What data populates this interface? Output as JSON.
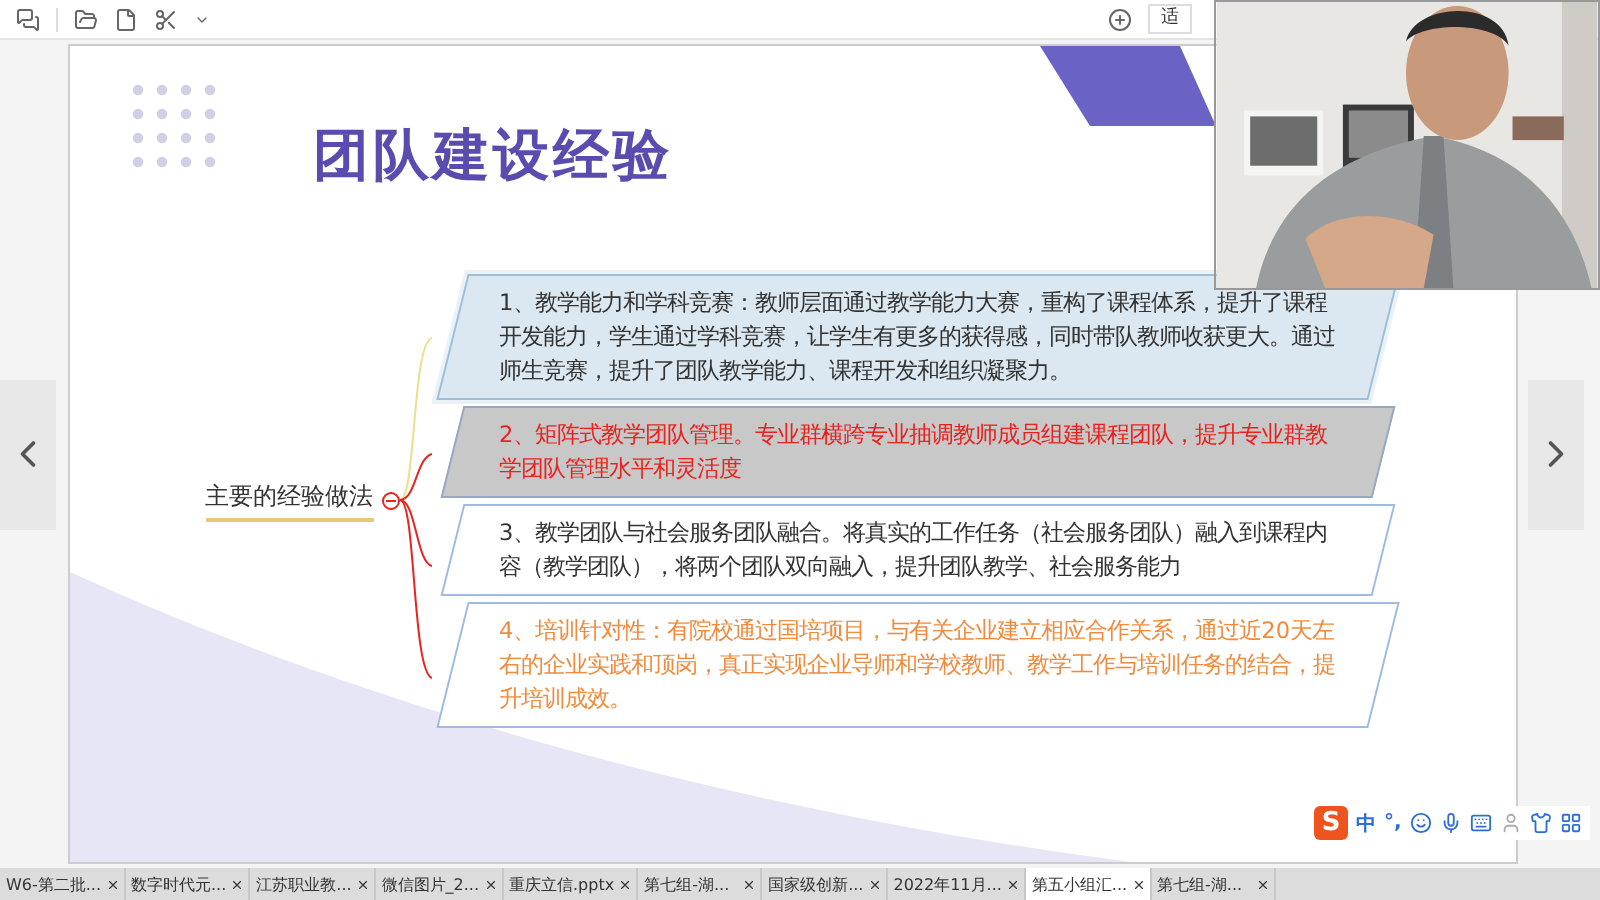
{
  "toolbar": {
    "fit_button": "适"
  },
  "slide": {
    "title": "团队建设经验",
    "main_topic": "主要的经验做法",
    "items": [
      {
        "kind": "tinted",
        "color": "#333333",
        "text": "1、教学能力和学科竞赛：教师层面通过教学能力大赛，重构了课程体系，提升了课程开发能力，学生通过学科竞赛，让学生有更多的获得感，同时带队教师收获更大。通过师生竞赛，提升了团队教学能力、课程开发和组织凝聚力。"
      },
      {
        "kind": "shaded",
        "color": "#e8231f",
        "text": "2、矩阵式教学团队管理。专业群横跨专业抽调教师成员组建课程团队，提升专业群教学团队管理水平和灵活度"
      },
      {
        "kind": "plain",
        "color": "#333333",
        "text": "3、教学团队与社会服务团队融合。将真实的工作任务（社会服务团队）融入到课程内容（教学团队），将两个团队双向融入，提升团队教学、社会服务能力"
      },
      {
        "kind": "plain",
        "color": "#f08a3c",
        "text": "4、培训针对性：有院校通过国培项目，与有关企业建立相应合作关系，通过近20天左右的企业实践和顶岗，真正实现企业导师和学校教师、教学工作与培训任务的结合，提升培训成效。"
      }
    ]
  },
  "ime": {
    "logo": "S",
    "mode": "中",
    "punctuation": "°,"
  },
  "tabs": [
    {
      "label": "W6-第二批...",
      "selected": false
    },
    {
      "label": "数字时代元...",
      "selected": false
    },
    {
      "label": "江苏职业教...",
      "selected": false
    },
    {
      "label": "微信图片_2...",
      "selected": false
    },
    {
      "label": "重庆立信.pptx",
      "selected": false
    },
    {
      "label": "第七组-湖...",
      "selected": false
    },
    {
      "label": "国家级创新...",
      "selected": false
    },
    {
      "label": "2022年11月...",
      "selected": false
    },
    {
      "label": "第五小组汇...",
      "selected": true
    },
    {
      "label": "第七组-湖...",
      "selected": false
    }
  ]
}
